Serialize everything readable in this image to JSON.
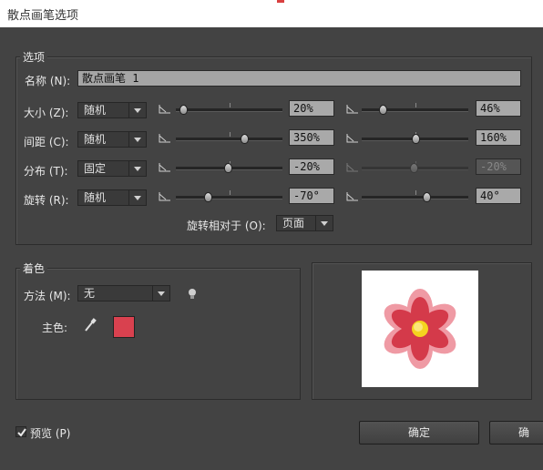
{
  "window": {
    "title": "散点画笔选项"
  },
  "options_group": {
    "legend": "选项",
    "name_label": "名称 (N):",
    "name_value": "散点画笔 1",
    "rows": [
      {
        "label": "大小 (Z):",
        "mode": "随机",
        "min_value": "20%",
        "max_value": "46%",
        "min_fraction": 0.07,
        "max_fraction": 0.2,
        "disabled_max": false
      },
      {
        "label": "间距 (C):",
        "mode": "随机",
        "min_value": "350%",
        "max_value": "160%",
        "min_fraction": 0.64,
        "max_fraction": 0.5,
        "disabled_max": false
      },
      {
        "label": "分布 (T):",
        "mode": "固定",
        "min_value": "-20%",
        "max_value": "-20%",
        "min_fraction": 0.49,
        "max_fraction": 0.49,
        "disabled_max": true
      },
      {
        "label": "旋转 (R):",
        "mode": "随机",
        "min_value": "-70°",
        "max_value": "40°",
        "min_fraction": 0.3,
        "max_fraction": 0.61,
        "disabled_max": false
      }
    ],
    "rotation_relative_label": "旋转相对于 (O):",
    "rotation_relative_value": "页面"
  },
  "colorization_group": {
    "legend": "着色",
    "method_label": "方法 (M):",
    "method_value": "无",
    "key_color_label": "主色:",
    "key_color": "#d9414f",
    "tips_icon": "lightbulb-icon",
    "eyedropper_icon": "eyedropper-icon"
  },
  "preview_swatch": {
    "icon": "flower-icon"
  },
  "footer": {
    "preview_label": "预览 (P)",
    "preview_checked": true,
    "ok_label": "确定",
    "cancel_label": "确"
  },
  "colors": {
    "dialog_bg": "#434343",
    "field_bg": "#a9a9a9",
    "flower_outer": "#ef9aa4",
    "flower_inner": "#d43a4a",
    "flower_center": "#f5d320"
  }
}
